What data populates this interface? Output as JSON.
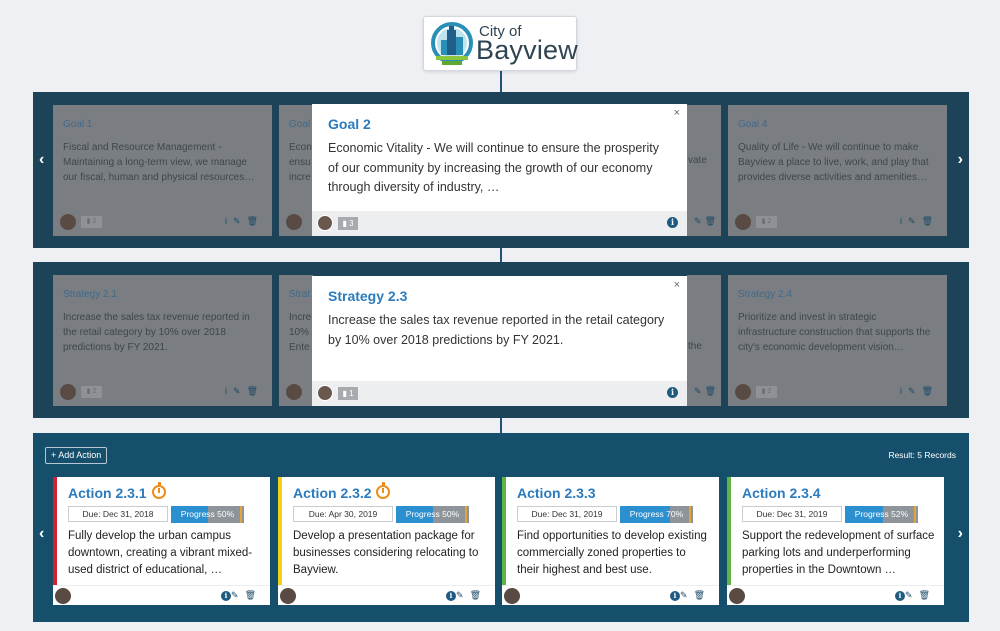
{
  "logo": {
    "prefix": "City of",
    "name": "Bayview"
  },
  "nav": {
    "prev": "‹",
    "next": "›"
  },
  "goals": {
    "dim_cards": [
      {
        "title": "Goal 1",
        "text": "Fiscal and Resource Management - Maintaining a long-term view, we manage our fiscal, human and physical resources…",
        "badge": "▮ 2"
      },
      {
        "title": "Goal",
        "text": "Econ ensu incre",
        "badge": ""
      },
      {
        "title": "",
        "text": "vate",
        "badge": ""
      },
      {
        "title": "Goal 4",
        "text": "Quality of Life - We will continue to make Bayview a place to live, work, and play that provides diverse activities and amenities…",
        "badge": "▮ 2"
      }
    ],
    "popup": {
      "title": "Goal 2",
      "text": "Economic Vitality - We will continue to ensure the prosperity of our community by increasing the growth of our economy through diversity of industry, …",
      "badge": "▮ 3",
      "close": "×"
    }
  },
  "strategies": {
    "dim_cards": [
      {
        "title": "Strategy 2.1",
        "text": "Increase the sales tax revenue reported in the retail category by 10% over 2018 predictions by FY 2021.",
        "badge": "▮ 2"
      },
      {
        "title": "Strat",
        "text": "Incre 10% Ente",
        "badge": ""
      },
      {
        "title": "",
        "text": "the",
        "badge": ""
      },
      {
        "title": "Strategy 2.4",
        "text": "Prioritize and invest in strategic infrastructure construction that supports the city's economic development vision…",
        "badge": "▮ 2"
      }
    ],
    "popup": {
      "title": "Strategy 2.3",
      "text": "Increase the sales tax revenue reported in the retail category by 10% over 2018 predictions by FY 2021.",
      "badge": "▮ 1",
      "close": "×"
    }
  },
  "actions": {
    "add_label": "+ Add Action",
    "result": "Result: 5 Records",
    "cards": [
      {
        "title": "Action 2.3.1",
        "due": "Due: Dec 31, 2018",
        "progress_label": "Progress 50%",
        "progress": 0.5,
        "text": "Fully develop the urban campus downtown, creating a vibrant mixed-used district of educational, …",
        "color": "#d6202f",
        "clock": true
      },
      {
        "title": "Action 2.3.2",
        "due": "Due: Apr 30, 2019",
        "progress_label": "Progress 50%",
        "progress": 0.5,
        "text": "Develop a presentation package for businesses considering relocating to Bayview.",
        "color": "#f2d01b",
        "clock": true
      },
      {
        "title": "Action 2.3.3",
        "due": "Due: Dec 31, 2019",
        "progress_label": "Progress 70%",
        "progress": 0.7,
        "text": "Find opportunities to develop existing commercially zoned properties to their highest and best use.",
        "color": "#5fb447",
        "clock": false
      },
      {
        "title": "Action 2.3.4",
        "due": "Due: Dec 31, 2019",
        "progress_label": "Progress 52%",
        "progress": 0.52,
        "text": "Support the redevelopment of surface parking lots and underperforming properties in the Downtown …",
        "color": "#5fb447",
        "clock": false
      }
    ]
  },
  "icons": {
    "info": "i",
    "edit": "✎",
    "delete": "🗑"
  },
  "colors": {
    "band": "#1d4358",
    "action_band": "#154f6b",
    "link": "#2b7bbd"
  }
}
